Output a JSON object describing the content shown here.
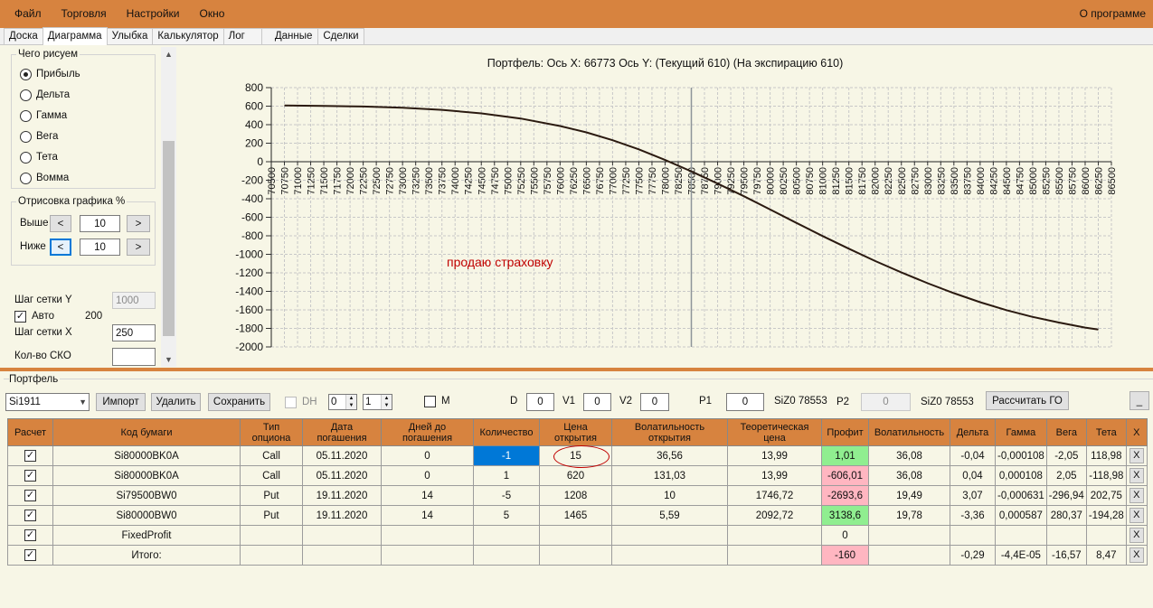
{
  "menu": {
    "items": [
      "Файл",
      "Торговля",
      "Настройки",
      "Окно"
    ],
    "about": "О программе"
  },
  "tabs": [
    "Доска",
    "Диаграмма",
    "Улыбка",
    "Калькулятор",
    "Лог",
    "Данные",
    "Сделки"
  ],
  "left": {
    "plot_group_title": "Чего рисуем",
    "radios": [
      "Прибыль",
      "Дельта",
      "Гамма",
      "Вега",
      "Тета",
      "Вомма"
    ],
    "selected_radio": "Прибыль",
    "range_group_title": "Отрисовка графика %",
    "above_label": "Выше",
    "below_label": "Ниже",
    "prev_symbol": "<",
    "next_symbol": ">",
    "above_value": "10",
    "below_value": "10",
    "grid_y_label": "Шаг сетки Y",
    "grid_y_value": "1000",
    "auto_label": "Авто",
    "auto_checked": true,
    "auto_value": "200",
    "grid_x_label": "Шаг сетки X",
    "grid_x_value": "250",
    "sko_label": "Кол-во СКО",
    "sko_value": ""
  },
  "chart_data": {
    "type": "line",
    "title": "Портфель: Ось X: 66773 Ось Y:  (Текущий 610)  (На экспирацию 610)",
    "annotation": "продаю страховку",
    "xlim": [
      70500,
      86500
    ],
    "x_ticks": [
      70500,
      70750,
      71000,
      71250,
      71500,
      71750,
      72000,
      72250,
      72500,
      72750,
      73000,
      73250,
      73500,
      73750,
      74000,
      74250,
      74500,
      74750,
      75000,
      75250,
      75500,
      75750,
      76000,
      76250,
      76500,
      76750,
      77000,
      77250,
      77500,
      77750,
      78000,
      78250,
      78500,
      78750,
      79000,
      79250,
      79500,
      79750,
      80000,
      80250,
      80500,
      80750,
      81000,
      81250,
      81500,
      81750,
      82000,
      82250,
      82500,
      82750,
      83000,
      83250,
      83500,
      83750,
      84000,
      84250,
      84500,
      84750,
      85000,
      85250,
      85500,
      85750,
      86000,
      86250,
      86500
    ],
    "ylim": [
      -2000,
      800
    ],
    "y_ticks": [
      800,
      600,
      400,
      200,
      0,
      -200,
      -400,
      -600,
      -800,
      -1000,
      -1200,
      -1400,
      -1600,
      -1800,
      -2000
    ],
    "vertical_marker_x": 78500,
    "grid": true,
    "series": [
      {
        "color": "#2b1a10",
        "x": [
          70750,
          71500,
          72250,
          73000,
          73750,
          74500,
          75250,
          76000,
          76500,
          77000,
          77500,
          78000,
          78500,
          79000,
          79500,
          80000,
          80500,
          81000,
          81500,
          82000,
          82500,
          83000,
          83500,
          84000,
          84500,
          85000,
          85500,
          86000,
          86250
        ],
        "y": [
          607,
          603,
          596,
          583,
          560,
          522,
          466,
          385,
          317,
          232,
          134,
          19,
          -104,
          -236,
          -373,
          -516,
          -660,
          -803,
          -940,
          -1072,
          -1196,
          -1312,
          -1420,
          -1517,
          -1603,
          -1676,
          -1737,
          -1791,
          -1812
        ]
      }
    ]
  },
  "portfolio": {
    "title": "Портфель",
    "instrument": "Si1911",
    "import_label": "Импорт",
    "delete_label": "Удалить",
    "save_label": "Сохранить",
    "dh_label": "DH",
    "dh_checked": false,
    "spin1": "0",
    "spin2": "1",
    "m_label": "M",
    "m_checked": false,
    "d_label": "D",
    "d_value": "0",
    "v1_label": "V1",
    "v1_value": "0",
    "v2_label": "V2",
    "v2_value": "0",
    "p1_label": "P1",
    "p1_value": "0",
    "p1_info": "SiZ0 78553",
    "p2_label": "P2",
    "p2_value": "0",
    "p2_info": "SiZ0 78553",
    "calc_go_label": "Рассчитать ГО",
    "minimize_label": "_"
  },
  "table": {
    "headers": [
      "Расчет",
      "Код бумаги",
      "Тип опциона",
      "Дата погашения",
      "Дней до погашения",
      "Количество",
      "Цена открытия",
      "Волатильность открытия",
      "Теоретическая цена",
      "Профит",
      "Волатильность",
      "Дельта",
      "Гамма",
      "Вега",
      "Тета",
      "X"
    ],
    "rows": [
      {
        "calc": true,
        "code": "Si80000BK0A",
        "type": "Call",
        "date": "05.11.2020",
        "days": "0",
        "qty": "-1",
        "price": "15",
        "vol_open": "36,56",
        "theo": "13,99",
        "profit": "1,01",
        "profit_color": "green",
        "vol": "36,08",
        "delta": "-0,04",
        "gamma": "-0,000108",
        "vega": "-2,05",
        "theta": "118,98",
        "x": "X"
      },
      {
        "calc": true,
        "code": "Si80000BK0A",
        "type": "Call",
        "date": "05.11.2020",
        "days": "0",
        "qty": "1",
        "price": "620",
        "vol_open": "131,03",
        "theo": "13,99",
        "profit": "-606,01",
        "profit_color": "red",
        "vol": "36,08",
        "delta": "0,04",
        "gamma": "0,000108",
        "vega": "2,05",
        "theta": "-118,98",
        "x": "X"
      },
      {
        "calc": true,
        "code": "Si79500BW0",
        "type": "Put",
        "date": "19.11.2020",
        "days": "14",
        "qty": "-5",
        "price": "1208",
        "vol_open": "10",
        "theo": "1746,72",
        "profit": "-2693,6",
        "profit_color": "red",
        "vol": "19,49",
        "delta": "3,07",
        "gamma": "-0,000631",
        "vega": "-296,94",
        "theta": "202,75",
        "x": "X"
      },
      {
        "calc": true,
        "code": "Si80000BW0",
        "type": "Put",
        "date": "19.11.2020",
        "days": "14",
        "qty": "5",
        "price": "1465",
        "vol_open": "5,59",
        "theo": "2092,72",
        "profit": "3138,6",
        "profit_color": "green",
        "vol": "19,78",
        "delta": "-3,36",
        "gamma": "0,000587",
        "vega": "280,37",
        "theta": "-194,28",
        "x": "X"
      },
      {
        "calc": true,
        "code": "FixedProfit",
        "type": "",
        "date": "",
        "days": "",
        "qty": "",
        "price": "",
        "vol_open": "",
        "theo": "",
        "profit": "0",
        "profit_color": "none",
        "vol": "",
        "delta": "",
        "gamma": "",
        "vega": "",
        "theta": "",
        "x": "X"
      },
      {
        "calc": true,
        "code": "Итого:",
        "type": "",
        "date": "",
        "days": "",
        "qty": "",
        "price": "",
        "vol_open": "",
        "theo": "",
        "profit": "-160",
        "profit_color": "red",
        "vol": "",
        "delta": "-0,29",
        "gamma": "-4,4E-05",
        "vega": "-16,57",
        "theta": "8,47",
        "x": "X"
      }
    ]
  },
  "colors": {
    "accent": "#d7833f",
    "background": "#f7f6e6",
    "selected": "#0078d7",
    "positive": "#90ee90",
    "negative": "#ffb6c1",
    "annotation": "#c00000"
  }
}
